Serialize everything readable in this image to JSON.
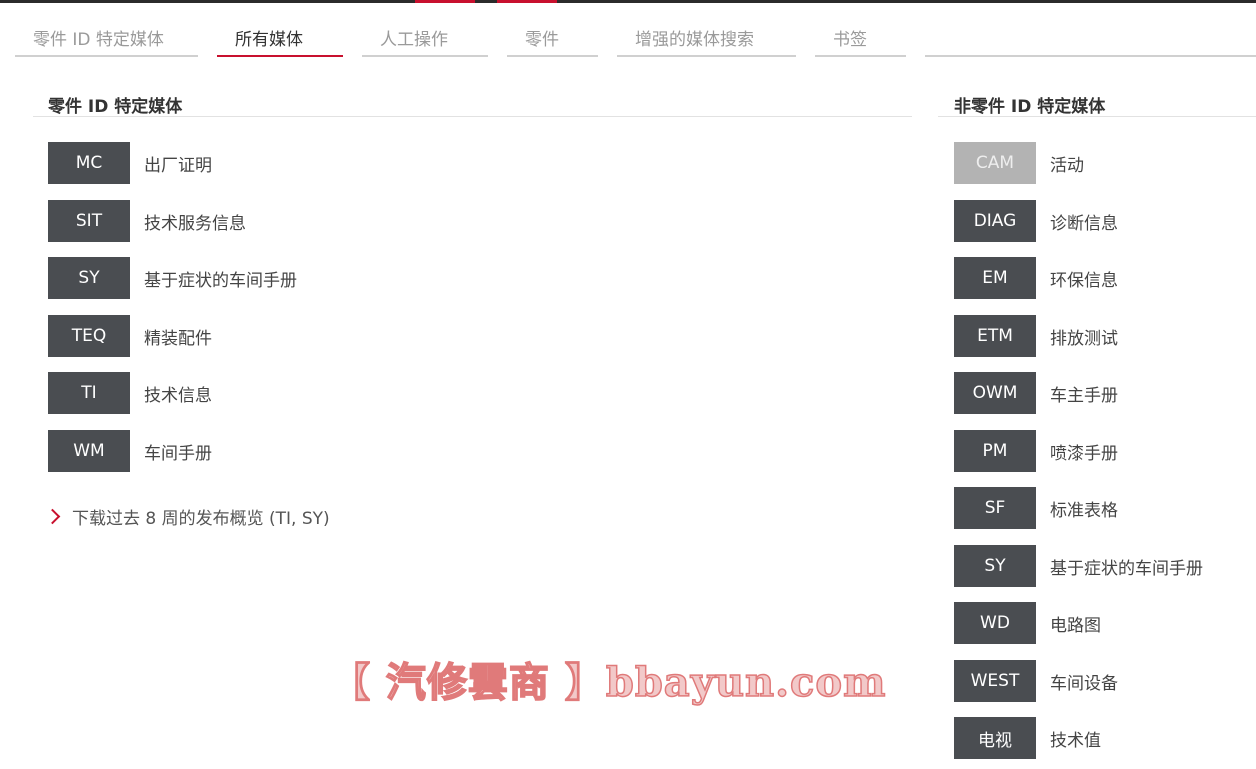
{
  "tabs": [
    {
      "label": "零件 ID 特定媒体",
      "active": false
    },
    {
      "label": "所有媒体",
      "active": true
    },
    {
      "label": "人工操作",
      "active": false
    },
    {
      "label": "零件",
      "active": false
    },
    {
      "label": "增强的媒体搜索",
      "active": false
    },
    {
      "label": "书签",
      "active": false
    }
  ],
  "left": {
    "title": "零件 ID 特定媒体",
    "items": [
      {
        "code": "MC",
        "label": "出厂证明"
      },
      {
        "code": "SIT",
        "label": "技术服务信息"
      },
      {
        "code": "SY",
        "label": "基于症状的车间手册"
      },
      {
        "code": "TEQ",
        "label": "精装配件"
      },
      {
        "code": "TI",
        "label": "技术信息"
      },
      {
        "code": "WM",
        "label": "车间手册"
      }
    ],
    "download_link": "下载过去 8 周的发布概览 (TI, SY)"
  },
  "right": {
    "title": "非零件 ID 特定媒体",
    "items": [
      {
        "code": "CAM",
        "label": "活动",
        "disabled": true
      },
      {
        "code": "DIAG",
        "label": "诊断信息"
      },
      {
        "code": "EM",
        "label": "环保信息"
      },
      {
        "code": "ETM",
        "label": "排放测试"
      },
      {
        "code": "OWM",
        "label": "车主手册"
      },
      {
        "code": "PM",
        "label": "喷漆手册"
      },
      {
        "code": "SF",
        "label": "标准表格"
      },
      {
        "code": "SY",
        "label": "基于症状的车间手册"
      },
      {
        "code": "WD",
        "label": "电路图"
      },
      {
        "code": "WEST",
        "label": "车间设备"
      },
      {
        "code": "电视",
        "label": "技术值"
      }
    ]
  },
  "watermark": "【 汽修雲商 】bbayun.com",
  "colors": {
    "accent": "#c8102e",
    "badge": "#4a4d51",
    "badge_disabled": "#b3b3b3"
  }
}
